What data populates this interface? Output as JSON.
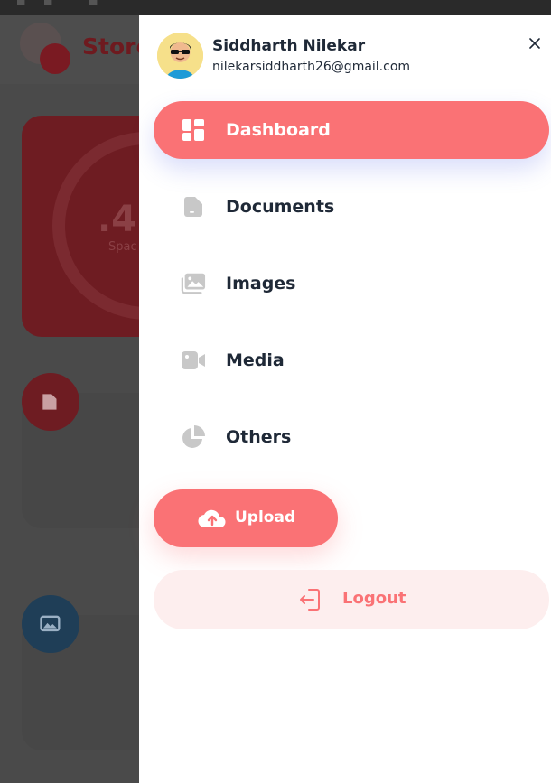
{
  "background": {
    "app_title": "Store",
    "storage_card": {
      "value": ".4",
      "label": "Spac"
    }
  },
  "user": {
    "name": "Siddharth Nilekar",
    "email": "nilekarsiddharth26@gmail.com"
  },
  "nav": {
    "items": [
      {
        "label": "Dashboard",
        "icon": "dashboard-icon",
        "active": true
      },
      {
        "label": "Documents",
        "icon": "document-icon",
        "active": false
      },
      {
        "label": "Images",
        "icon": "images-icon",
        "active": false
      },
      {
        "label": "Media",
        "icon": "video-icon",
        "active": false
      },
      {
        "label": "Others",
        "icon": "pie-chart-icon",
        "active": false
      }
    ]
  },
  "actions": {
    "upload_label": "Upload",
    "logout_label": "Logout"
  },
  "colors": {
    "brand": "#fa7275",
    "text": "#1f2937",
    "icon_gray": "#c8c8c8",
    "logout_bg": "#fdeeee"
  }
}
